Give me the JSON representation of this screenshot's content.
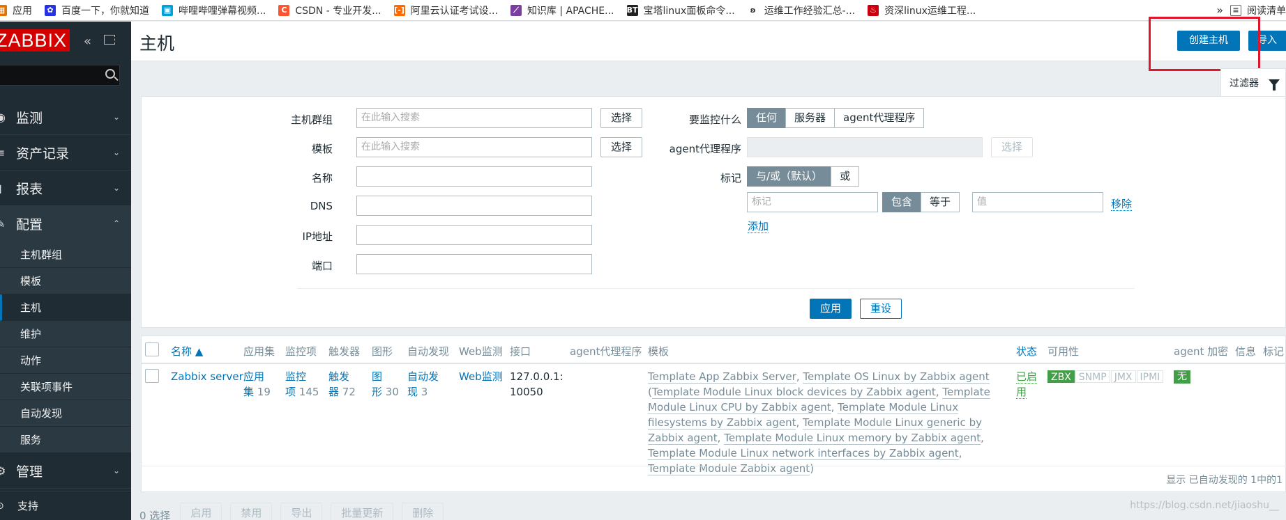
{
  "bookmarks": [
    {
      "label": "应用",
      "icon": "apps-icon",
      "color": "#e37400"
    },
    {
      "label": "百度一下，你就知道",
      "icon": "baidu-icon",
      "color": "#2932e1"
    },
    {
      "label": "哔哩哔哩弹幕视频...",
      "icon": "bilibili-icon",
      "color": "#00a1d6"
    },
    {
      "label": "CSDN - 专业开发...",
      "icon": "csdn-icon",
      "color": "#fc5531"
    },
    {
      "label": "阿里云认证考试设...",
      "icon": "aliyun-icon",
      "color": "#ff6a00"
    },
    {
      "label": "知识库 | APACHE...",
      "icon": "apache-icon",
      "color": "#7a3e9d"
    },
    {
      "label": "宝塔linux面板命令...",
      "icon": "bt-icon",
      "color": "#222222"
    },
    {
      "label": "运维工作经验汇总-...",
      "icon": "ops-icon",
      "color": "#555555"
    },
    {
      "label": "资深linux运维工程...",
      "icon": "linux-icon",
      "color": "#c7000b"
    }
  ],
  "bookmarks_more": "»",
  "reading_list": "阅读清单",
  "sidebar": {
    "logo": "ZABBIX",
    "menu": [
      {
        "label": "监测",
        "icon": "eye-icon"
      },
      {
        "label": "资产记录",
        "icon": "list-icon"
      },
      {
        "label": "报表",
        "icon": "report-icon"
      },
      {
        "label": "配置",
        "icon": "wrench-icon"
      }
    ],
    "submenu": [
      "主机群组",
      "模板",
      "主机",
      "维护",
      "动作",
      "关联项事件",
      "自动发现",
      "服务"
    ],
    "admin": "管理",
    "support": "支持"
  },
  "header": {
    "title": "主机",
    "create_btn": "创建主机",
    "import_btn": "导入"
  },
  "filter_tab": "过滤器",
  "filter": {
    "host_groups_label": "主机群组",
    "host_groups_placeholder": "在此输入搜索",
    "templates_label": "模板",
    "templates_placeholder": "在此输入搜索",
    "select_btn": "选择",
    "name_label": "名称",
    "dns_label": "DNS",
    "ip_label": "IP地址",
    "port_label": "端口",
    "monitored_by_label": "要监控什么",
    "monitored_by_options": [
      "任何",
      "服务器",
      "agent代理程序"
    ],
    "proxy_label": "agent代理程序",
    "tags_label": "标记",
    "tags_options": [
      "与/或（默认）",
      "或"
    ],
    "tag_placeholder": "标记",
    "tag_ops": [
      "包含",
      "等于"
    ],
    "value_placeholder": "值",
    "remove": "移除",
    "add": "添加",
    "apply": "应用",
    "reset": "重设"
  },
  "table": {
    "headers": {
      "name": "名称 ▲",
      "apps": "应用集",
      "items": "监控项",
      "triggers": "触发器",
      "graphs": "图形",
      "discovery": "自动发现",
      "web": "Web监测",
      "interface": "接口",
      "proxy": "agent代理程序",
      "templates": "模板",
      "status": "状态",
      "availability": "可用性",
      "encryption": "agent 加密",
      "info": "信息",
      "tags": "标记"
    },
    "row": {
      "name": "Zabbix server",
      "apps_l1": "应用",
      "apps_l2": "集",
      "apps_n": "19",
      "items_l1": "监控",
      "items_l2": "项",
      "items_n": "145",
      "triggers_l1": "触发",
      "triggers_l2": "器",
      "triggers_n": "72",
      "graphs_l1": "图",
      "graphs_l2": "形",
      "graphs_n": "30",
      "discovery_l1": "自动发",
      "discovery_l2": "现",
      "discovery_n": "3",
      "web": "Web监测",
      "interface_l1": "127.0.0.1:",
      "interface_l2": "10050",
      "tmpl": {
        "t1": "Template App Zabbix Server",
        "t2": "Template OS Linux by Zabbix agent",
        "t3": "Template Module Linux block devices by Zabbix agent",
        "t4": "Template Module Linux CPU by Zabbix agent",
        "t5": "Template Module Linux filesystems by Zabbix agent",
        "t6": "Template Module Linux generic by Zabbix agent",
        "t7": "Template Module Linux memory by Zabbix agent",
        "t8": "Template Module Linux network interfaces by Zabbix agent",
        "t9": "Template Module Zabbix agent"
      },
      "status_l1": "已启",
      "status_l2": "用",
      "availability": [
        "ZBX",
        "SNMP",
        "JMX",
        "IPMI"
      ],
      "encryption": "无"
    },
    "footer": "显示 已自动发现的 1中的1"
  },
  "actions": {
    "selected": "0 选择",
    "buttons": [
      "启用",
      "禁用",
      "导出",
      "批量更新",
      "删除"
    ]
  },
  "watermark": "https://blog.csdn.net/jiaoshu__"
}
